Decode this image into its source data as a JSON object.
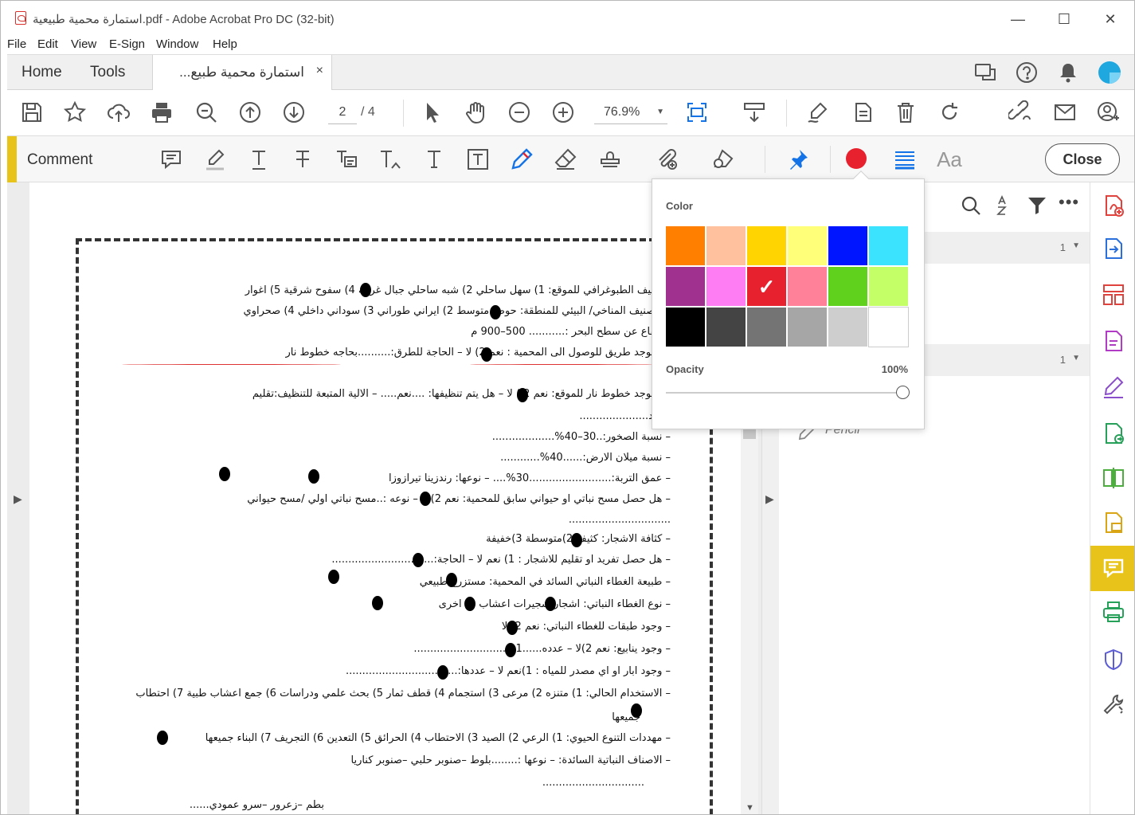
{
  "window": {
    "title": "استمارة محمية طبيعية.pdf - Adobe Acrobat Pro DC (32-bit)",
    "minimize": "—",
    "maximize": "☐",
    "close": "✕"
  },
  "menu": [
    "File",
    "Edit",
    "View",
    "E-Sign",
    "Window",
    "Help"
  ],
  "tabs": {
    "home": "Home",
    "tools": "Tools",
    "document": "استمارة محمية طبيع...",
    "close": "×"
  },
  "toolbar": {
    "page_current": "2",
    "page_total": "/ 4",
    "zoom": "76.9%",
    "zoom_caret": "▼"
  },
  "comment_bar": {
    "label": "Comment",
    "close": "Close",
    "active_color": "#e8212f",
    "font_label": "Aa"
  },
  "color_popup": {
    "heading": "Color",
    "swatches": [
      "#ff7f00",
      "#ffc19e",
      "#ffd400",
      "#ffff7a",
      "#0015ff",
      "#3ce3ff",
      "#a1318e",
      "#ff7df2",
      "#e8212f",
      "#ff8199",
      "#60d21e",
      "#c4ff68",
      "#000000",
      "#444444",
      "#747474",
      "#a6a6a6",
      "#cecece",
      "#ffffff"
    ],
    "selected_index": 8,
    "opacity_label": "Opacity",
    "opacity_value": "100%",
    "opacity_fraction": 1.0
  },
  "right_pane": {
    "group1_count": "1",
    "group2_count": "1",
    "pencil_label": "Pencil"
  },
  "document": {
    "lines": [
      "التصنيف الطبوغرافي للموقع: 1) سهل ساحلي   2) شبه ساحلي   جبال غربية   4) سفوح شرقية   5) اغوار",
      "التصنيف المناخي/ البيئي للمنطقة: حوض متوسط   2) ايراني طوراني   3) سوداني داخلي   4) صحراوي",
      "الارتفاع عن سطح البحر :...........  500–900 م",
      "هل يوجد طريق للوصول الى المحمية :   نعم     2) لا            – الحاجة للطرق:..........بحاجه خطوط نار",
      "هل يوجد خطوط نار للموقع: نعم  2 ) لا     – هل يتم تنظيفها: ....نعم.....     – الالية المتبعة للتنظيف:تقليم",
      "تفريد.....................",
      "–   نسبة الصخور:..30–40%...................",
      "–   نسبة ميلان الارض:......40%............",
      "–   عمق التربة:.........................30%....     – نوعها:     رندزينا       تيرازوزا",
      "–   هل حصل مسح نباتي او حيواني سابق للمحمية:   نعم       2) لا     – نوعه :..مسح نباتي اولي /مسح حيواني",
      "...............................",
      "–   كثافة الاشجار: كثيفة          2)متوسطة               3)خفيفة",
      "–   هل حصل تفريد او تقليم للاشجار :   1) نعم    لا       – الحاجة:...............................",
      "–   طبيعة الغطاء النباتي السائد في المحمية:   مستزرع        طبيعي",
      "–   نوع الغطاء النباتي:  اشجار     شجيرات       اعشاب      4) اخرى",
      "–   وجود طبقات للغطاء النباتي: نعم       2) لا",
      "–   وجود ينابيع:           نعم        2)لا           – عدده......1...............................",
      "–   وجود ابار او اي مصدر للمياه  :  1)نعم    لا         – عددها:..................................",
      "–   الاستخدام الحالي: 1) متنزه  2) مرعى 3) استجمام 4) قطف ثمار 5) بحث علمي ودراسات 6) جمع اعشاب طبية 7) احتطاب",
      "جميعها",
      "–   مهددات التنوع الحيوي: 1) الرعي  2) الصيد  3) الاحتطاب  4) الحرائق  5) التعدين  6) التجريف  7) البناء  جميعها",
      "–   الاصناف النباتية السائدة:                    – نوعها :........بلوط –صنوبر حلبي –صنوبر كناريا",
      "...............................",
      "بطم –زعرور –سرو عمودي......"
    ]
  }
}
